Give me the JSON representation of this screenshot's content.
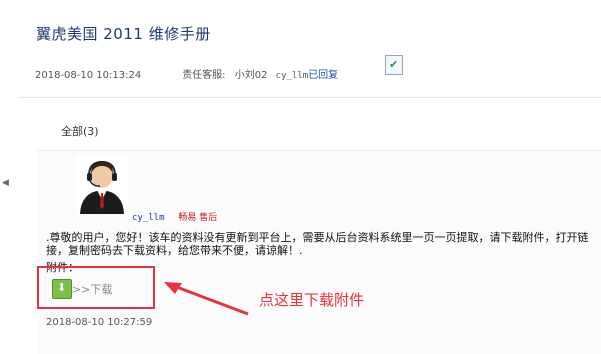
{
  "header": {
    "title": "翼虎美国 2011 维修手册",
    "date": "2018-08-10 10:13:24",
    "service_label": "责任客服:",
    "staff": "小刘02",
    "user": "cy_llm",
    "replied": "已回复",
    "check_icon": "check-icon"
  },
  "tabs": {
    "all": "全部(3)"
  },
  "post": {
    "avatar": "avatar-icon",
    "username": "cy_llm",
    "replier": "畅易 售后",
    "message": ".尊敬的用户，您好！该车的资料没有更新到平台上，需要从后台资料系统里一页一页提取，请下载附件，打开链接，复制密码去下载资料，给您带来不便，请谅解！.",
    "attach_label": "附件：",
    "download_text": ">>下载",
    "download_icon": "download-icon",
    "time": "2018-08-10 10:27:59"
  },
  "annotation": {
    "text": "点这里下载附件",
    "color": "#e8323c"
  }
}
